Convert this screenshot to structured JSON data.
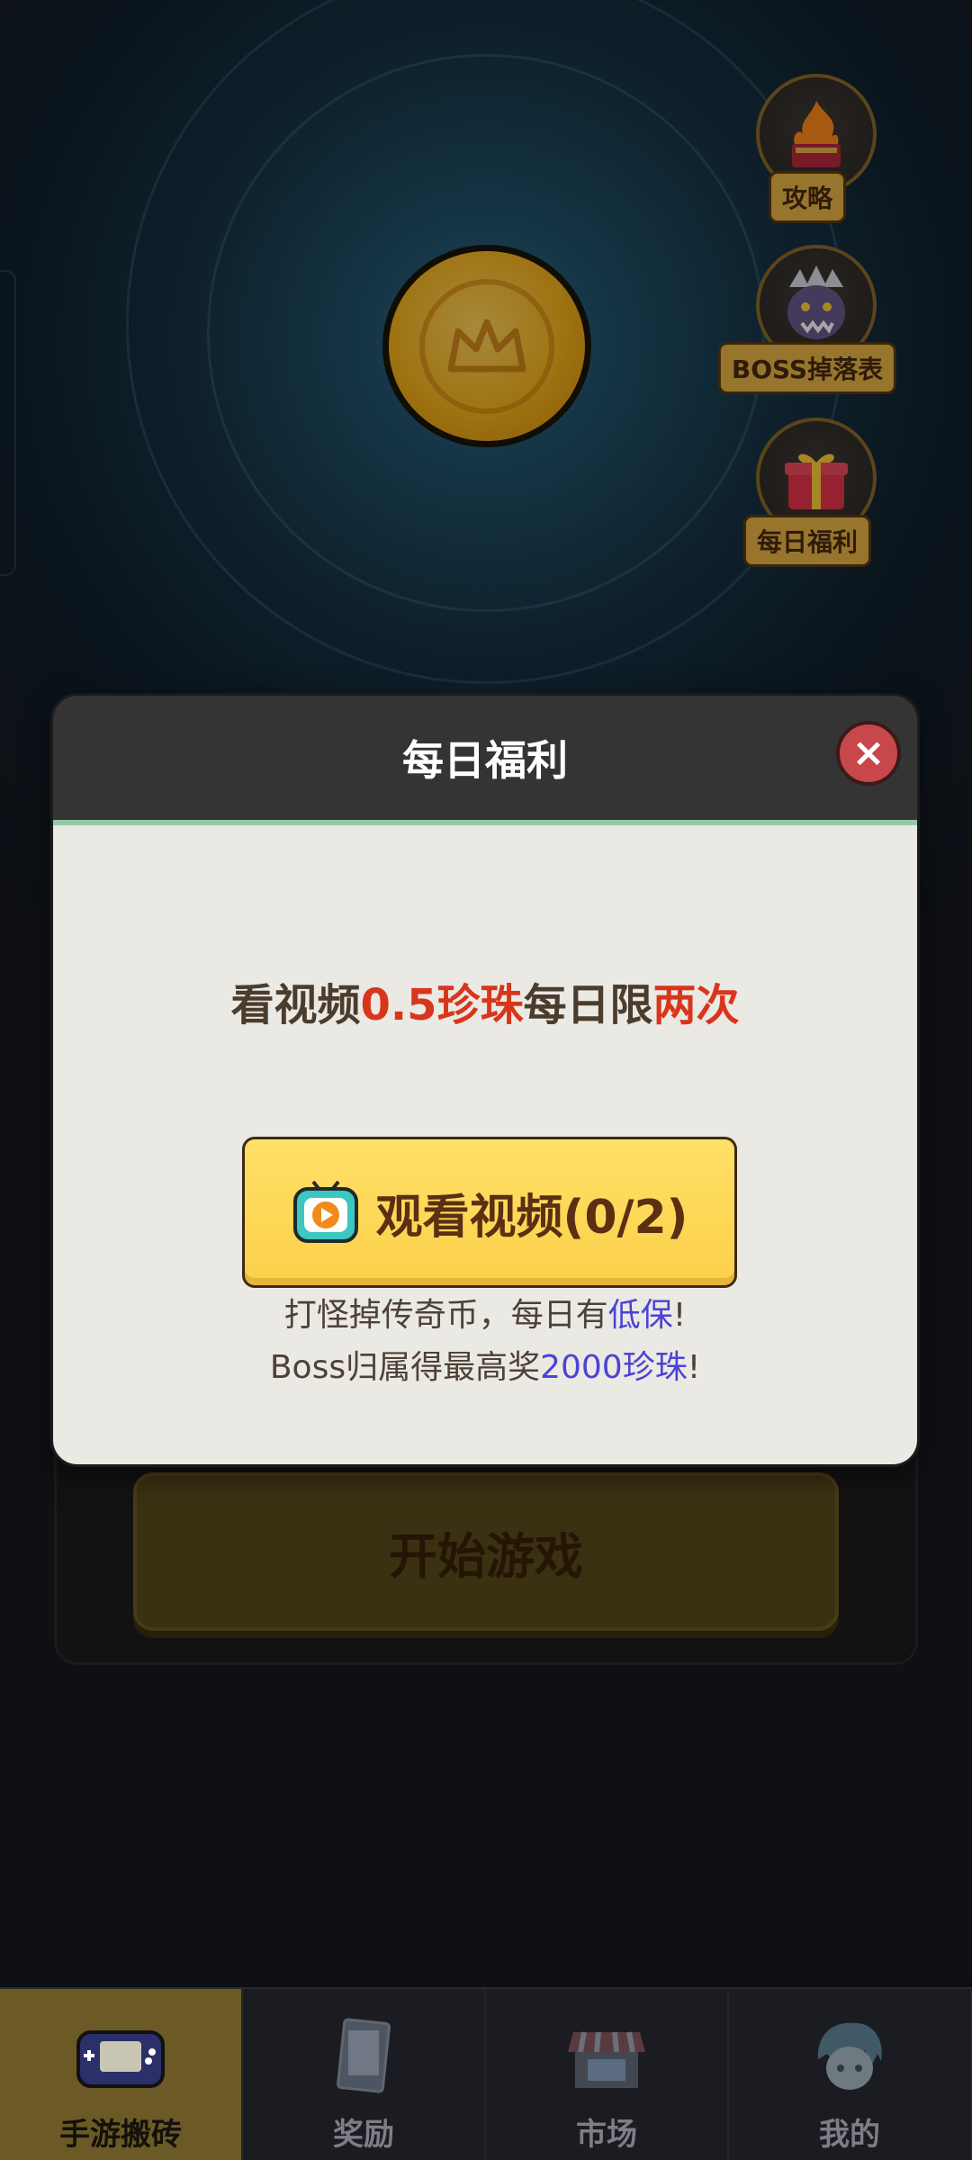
{
  "side_menu": [
    {
      "label": "攻略",
      "icon": "fire-book-icon"
    },
    {
      "label": "BOSS掉落表",
      "icon": "boss-monster-icon"
    },
    {
      "label": "每日福利",
      "icon": "gift-box-icon"
    }
  ],
  "game": {
    "start_label": "开始游戏"
  },
  "dialog": {
    "title": "每日福利",
    "close_symbol": "×",
    "promo": {
      "part1": "看视频",
      "highlight1": "0.5珍珠",
      "part2": "每日限",
      "highlight2": "两次"
    },
    "watch_button": {
      "label": "观看视频(0/2)",
      "watched": 0,
      "limit": 2
    },
    "info_line1": {
      "part1": "打怪掉传奇币，每日有",
      "highlight": "低保",
      "part2": "!"
    },
    "info_line2": {
      "part1": "Boss归属得最高奖",
      "highlight": "2000珍珠",
      "part2": "!"
    }
  },
  "bottom_nav": [
    {
      "label": "手游搬砖",
      "icon": "gamepad-icon",
      "active": true
    },
    {
      "label": "奖励",
      "icon": "reward-card-icon",
      "active": false
    },
    {
      "label": "市场",
      "icon": "market-stall-icon",
      "active": false
    },
    {
      "label": "我的",
      "icon": "avatar-icon",
      "active": false
    }
  ],
  "colors": {
    "accent_yellow": "#fcd04a",
    "highlight_red": "#d8361c",
    "highlight_blue": "#4b43d6",
    "close_red": "#c8474b"
  }
}
